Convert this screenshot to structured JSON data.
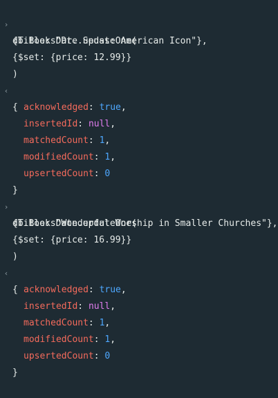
{
  "icons": {
    "input_prompt": "›",
    "output_marker": "‹"
  },
  "colors": {
    "background": "#1e2b33",
    "text": "#e8edeb",
    "key": "#f56b5c",
    "boolean": "#4ea8ff",
    "null": "#e27df0",
    "number": "#4ea8ff"
  },
  "blocks": [
    {
      "command": {
        "line1": "db.BooksDate.updateOne(",
        "line2": "{Title: \"Dr. Seuss: American Icon\"},",
        "line3": "{$set: {price: 12.99}}",
        "line4": ")"
      },
      "result": {
        "open": "{",
        "close": "}",
        "fields": [
          {
            "key": "acknowledged",
            "sep": ": ",
            "value": "true",
            "comma": ","
          },
          {
            "key": "insertedId",
            "sep": ": ",
            "value": "null",
            "comma": ","
          },
          {
            "key": "matchedCount",
            "sep": ": ",
            "value": "1",
            "comma": ","
          },
          {
            "key": "modifiedCount",
            "sep": ": ",
            "value": "1",
            "comma": ","
          },
          {
            "key": "upsertedCount",
            "sep": ": ",
            "value": "0",
            "comma": ""
          }
        ]
      }
    },
    {
      "command": {
        "line1": "db.BooksDate.updateOne(",
        "line2": "{Title: \"Wonderful Worship in Smaller Churches\"},",
        "line3": "{$set: {price: 16.99}}",
        "line4": ")"
      },
      "result": {
        "open": "{",
        "close": "}",
        "fields": [
          {
            "key": "acknowledged",
            "sep": ": ",
            "value": "true",
            "comma": ","
          },
          {
            "key": "insertedId",
            "sep": ": ",
            "value": "null",
            "comma": ","
          },
          {
            "key": "matchedCount",
            "sep": ": ",
            "value": "1",
            "comma": ","
          },
          {
            "key": "modifiedCount",
            "sep": ": ",
            "value": "1",
            "comma": ","
          },
          {
            "key": "upsertedCount",
            "sep": ": ",
            "value": "0",
            "comma": ""
          }
        ]
      }
    }
  ]
}
